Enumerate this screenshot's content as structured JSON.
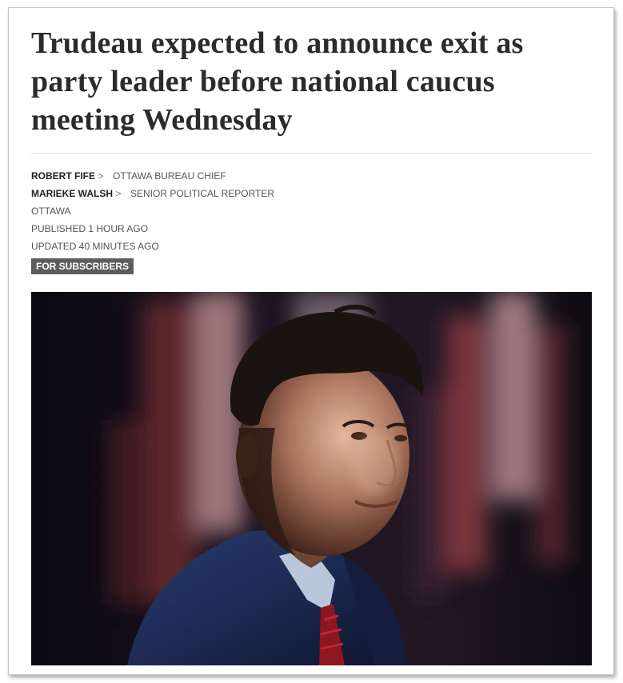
{
  "article": {
    "headline": "Trudeau expected to announce exit as party leader before national caucus meeting Wednesday",
    "authors": [
      {
        "name": "ROBERT FIFE",
        "title": "OTTAWA BUREAU CHIEF"
      },
      {
        "name": "MARIEKE WALSH",
        "title": "SENIOR POLITICAL REPORTER"
      }
    ],
    "dateline": "OTTAWA",
    "published": "PUBLISHED 1 HOUR AGO",
    "updated": "UPDATED 40 MINUTES AGO",
    "badge": "FOR SUBSCRIBERS",
    "chevron": ">"
  },
  "colors": {
    "headline": "#2b2b2b",
    "badge_bg": "#5d5d5d",
    "meta_text": "#555555"
  }
}
